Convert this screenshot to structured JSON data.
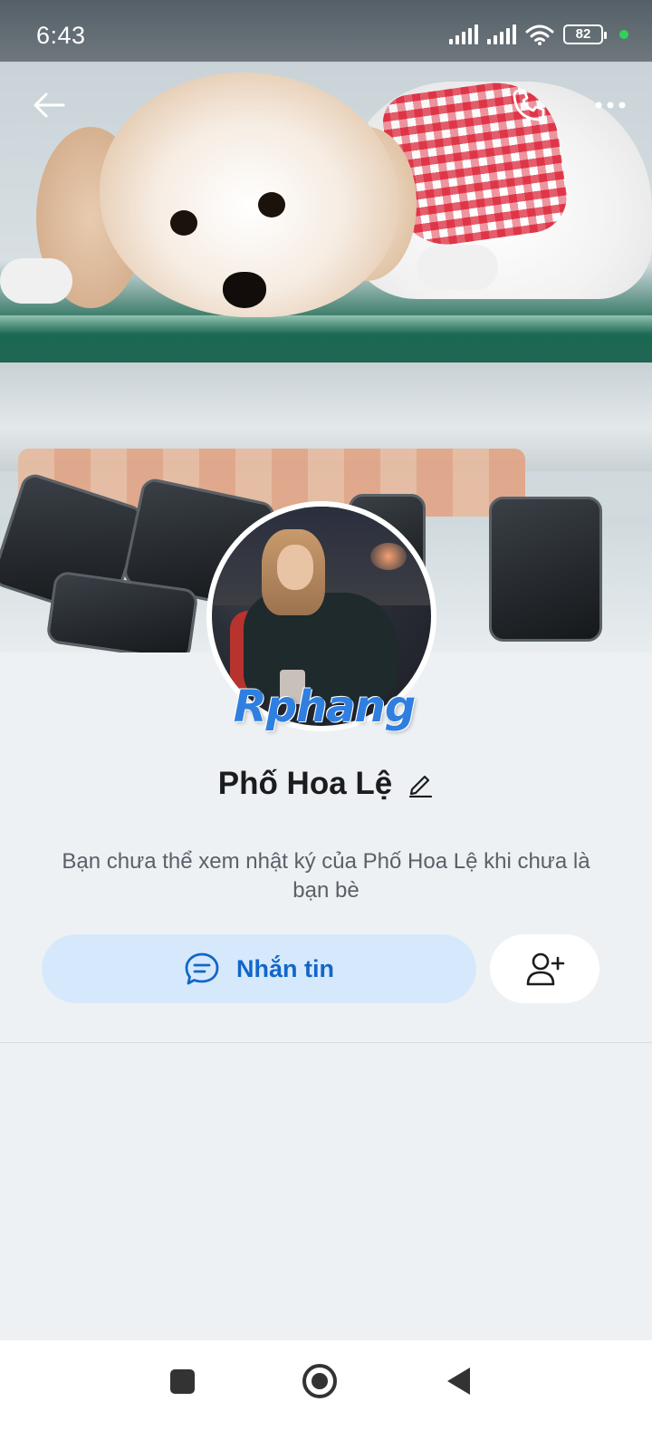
{
  "status_bar": {
    "time": "6:43",
    "battery": "82",
    "dot_color": "#2fd35a"
  },
  "header": {
    "back_icon": "arrow-left-icon",
    "call_icon": "phone-icon",
    "more_icon": "more-horizontal-icon"
  },
  "profile": {
    "name": "Phố Hoa Lệ",
    "watermark": "Rphang",
    "note": "Bạn chưa thể xem nhật ký của Phố Hoa Lệ khi chưa là bạn bè"
  },
  "actions": {
    "message_label": "Nhắn tin",
    "message_icon": "chat-bubble-icon",
    "add_friend_icon": "add-friend-icon"
  },
  "colors": {
    "accent": "#1266c9",
    "message_button_bg": "#d6e9fc",
    "page_bg": "#eef1f4"
  },
  "nav": {
    "recent_icon": "square-icon",
    "home_icon": "circle-icon",
    "back_icon": "triangle-back-icon"
  }
}
